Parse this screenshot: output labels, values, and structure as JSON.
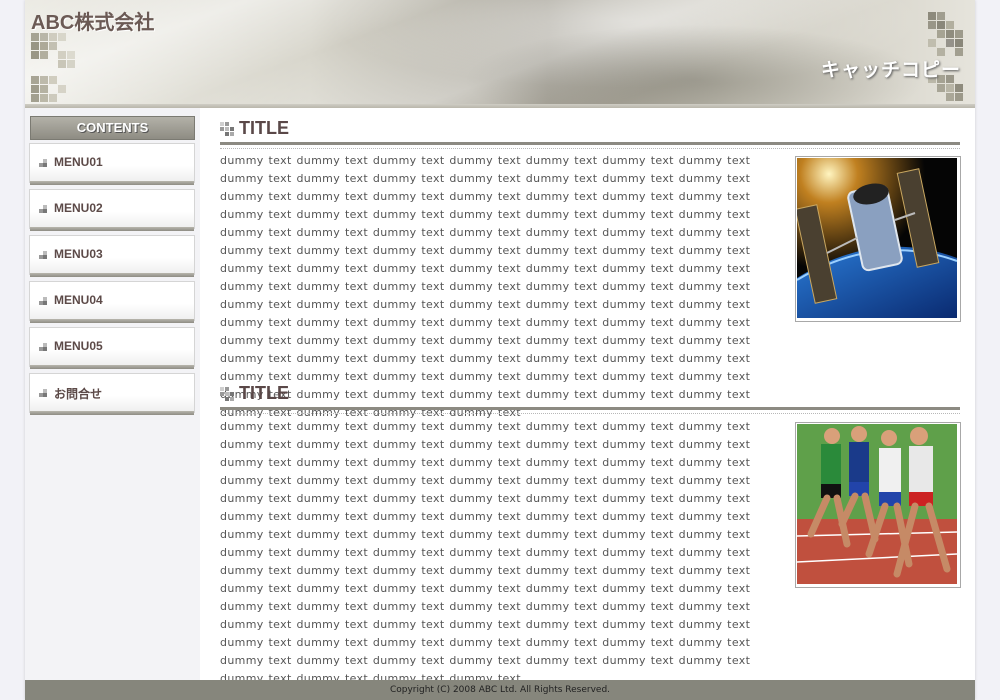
{
  "header": {
    "company_name": "ABC株式会社",
    "catch_copy": "キャッチコピー"
  },
  "sidebar": {
    "heading": "CONTENTS",
    "items": [
      {
        "label": "MENU01"
      },
      {
        "label": "MENU02"
      },
      {
        "label": "MENU03"
      },
      {
        "label": "MENU04"
      },
      {
        "label": "MENU05"
      },
      {
        "label": "お問合せ"
      }
    ]
  },
  "main": {
    "sections": [
      {
        "title": "TITLE",
        "body": "dummy text dummy text dummy text dummy text dummy text dummy text dummy text dummy text dummy text dummy text dummy text dummy text dummy text dummy text dummy text dummy text dummy text dummy text dummy text dummy text dummy text dummy text dummy text dummy text dummy text dummy text dummy text dummy text dummy text dummy text dummy text dummy text dummy text dummy text dummy text dummy text dummy text dummy text dummy text dummy text dummy text dummy text dummy text dummy text dummy text dummy text dummy text dummy text dummy text dummy text dummy text dummy text dummy text dummy text dummy text dummy text dummy text dummy text dummy text dummy text dummy text dummy text dummy text dummy text dummy text dummy text dummy text dummy text dummy text dummy text dummy text dummy text dummy text dummy text dummy text dummy text dummy text dummy text dummy text dummy text dummy text dummy text dummy text dummy text dummy text dummy text dummy text dummy text dummy text dummy text dummy text dummy text dummy text dummy text dummy text dummy text dummy text dummy text dummy text dummy text dummy text dummy text",
        "image_icon": "satellite-photo"
      },
      {
        "title": "TITLE",
        "body": "dummy text dummy text dummy text dummy text dummy text dummy text dummy text dummy text dummy text dummy text dummy text dummy text dummy text dummy text dummy text dummy text dummy text dummy text dummy text dummy text dummy text dummy text dummy text dummy text dummy text dummy text dummy text dummy text dummy text dummy text dummy text dummy text dummy text dummy text dummy text dummy text dummy text dummy text dummy text dummy text dummy text dummy text dummy text dummy text dummy text dummy text dummy text dummy text dummy text dummy text dummy text dummy text dummy text dummy text dummy text dummy text dummy text dummy text dummy text dummy text dummy text dummy text dummy text dummy text dummy text dummy text dummy text dummy text dummy text dummy text dummy text dummy text dummy text dummy text dummy text dummy text dummy text dummy text dummy text dummy text dummy text dummy text dummy text dummy text dummy text dummy text dummy text dummy text dummy text dummy text dummy text dummy text dummy text dummy text dummy text dummy text dummy text dummy text dummy text dummy text dummy text dummy text",
        "image_icon": "runners-photo"
      }
    ]
  },
  "footer": {
    "copyright": "Copyright (C) 2008 ABC Ltd. All Rights Reserved."
  },
  "colors": {
    "accent": "#5a4848",
    "rule": "#8c8a82",
    "footer_bg": "#86867c"
  }
}
